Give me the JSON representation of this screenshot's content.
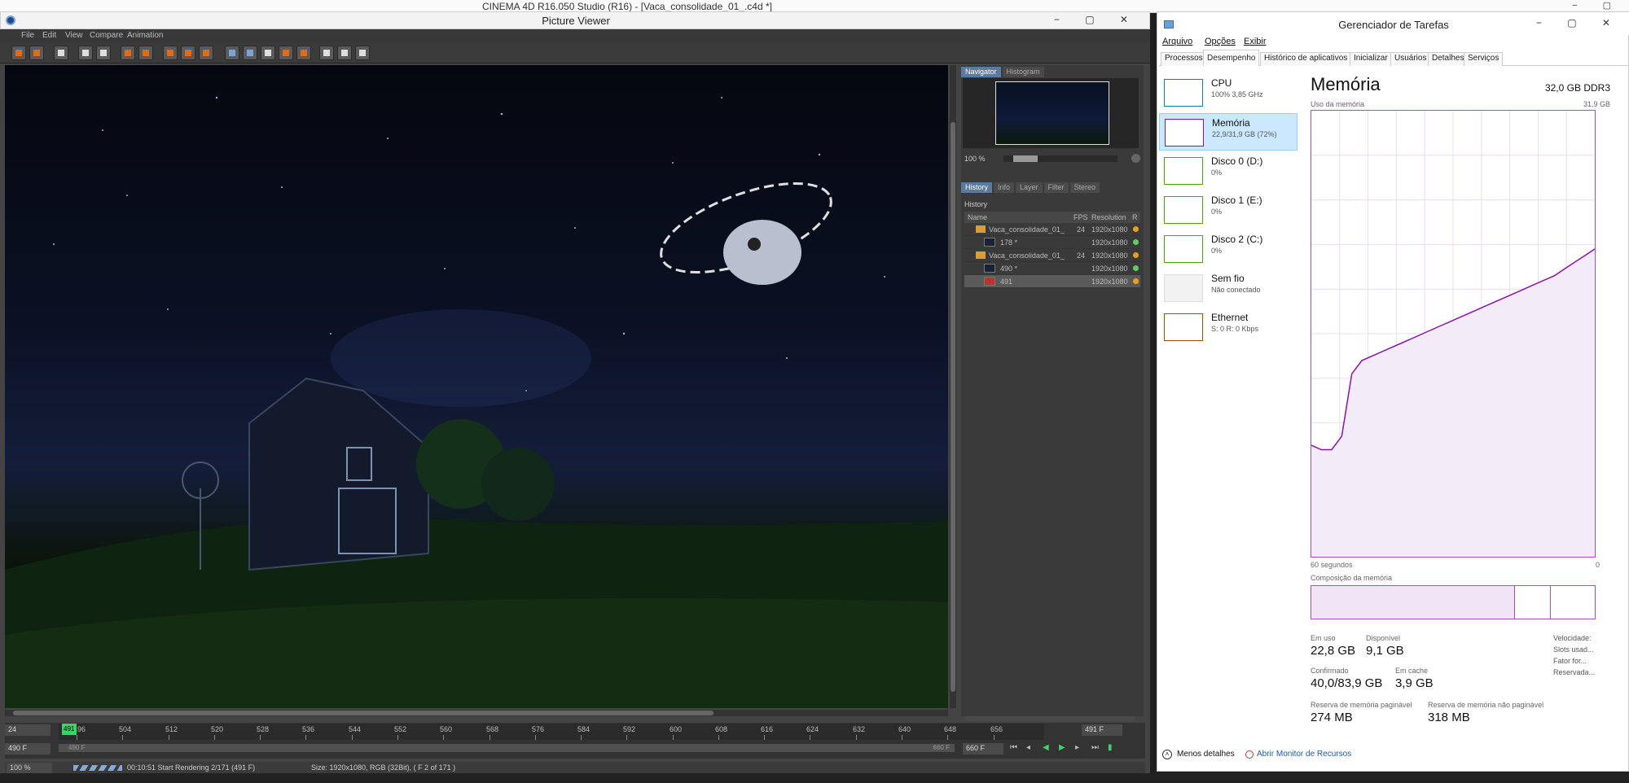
{
  "background_window": {
    "title": "CINEMA 4D R16.050 Studio (R16) - [Vaca_consolidade_01_.c4d *]"
  },
  "picture_viewer": {
    "title": "Picture Viewer",
    "menu": [
      "File",
      "Edit",
      "View",
      "Compare",
      "Animation"
    ],
    "navigator": {
      "tabs": [
        "Navigator",
        "Histogram"
      ],
      "zoom": "100 %"
    },
    "history_tabs": [
      "History",
      "Info",
      "Layer",
      "Filter",
      "Stereo"
    ],
    "history": {
      "label": "History",
      "columns": [
        "Name",
        "FPS",
        "Resolution",
        "R"
      ],
      "rows": [
        {
          "name": "Vaca_consolidade_01_",
          "fps": "24",
          "res": "1920x1080",
          "status": "orange"
        },
        {
          "name": "178 *",
          "fps": "",
          "res": "1920x1080",
          "status": "green"
        },
        {
          "name": "Vaca_consolidade_01_",
          "fps": "24",
          "res": "1920x1080",
          "status": "orange"
        },
        {
          "name": "490 *",
          "fps": "",
          "res": "1920x1080",
          "status": "green"
        },
        {
          "name": "491",
          "fps": "",
          "res": "1920x1080",
          "status": "orange"
        }
      ]
    },
    "timeline": {
      "fps": "24",
      "current": "491",
      "end": "491 F",
      "ticks": [
        "496",
        "504",
        "512",
        "520",
        "528",
        "536",
        "544",
        "552",
        "560",
        "568",
        "576",
        "584",
        "592",
        "600",
        "608",
        "616",
        "624",
        "632",
        "640",
        "648",
        "656"
      ],
      "start_field": "490 F",
      "range_start": "490 F",
      "range_end": "660 F",
      "end_field": "660 F"
    },
    "status": {
      "zoom": "100 %",
      "message": "00:10:51 Start Rendering 2/171 (491 F)",
      "size": "Size: 1920x1080, RGB (32Bit),  ( F 2 of 171 )"
    }
  },
  "task_manager": {
    "title": "Gerenciador de Tarefas",
    "menu": [
      "Arquivo",
      "Opções",
      "Exibir"
    ],
    "tabs": [
      "Processos",
      "Desempenho",
      "Histórico de aplicativos",
      "Inicializar",
      "Usuários",
      "Detalhes",
      "Serviços"
    ],
    "resources": [
      {
        "name": "CPU",
        "sub": "100% 3,85 GHz",
        "color": "#117dbb"
      },
      {
        "name": "Memória",
        "sub": "22,9/31,9 GB (72%)",
        "color": "#8b12ae"
      },
      {
        "name": "Disco 0 (D:)",
        "sub": "0%",
        "color": "#4da60c"
      },
      {
        "name": "Disco 1 (E:)",
        "sub": "0%",
        "color": "#4da60c"
      },
      {
        "name": "Disco 2 (C:)",
        "sub": "0%",
        "color": "#4da60c"
      },
      {
        "name": "Sem fio",
        "sub": "Não conectado",
        "color": "#a74f01"
      },
      {
        "name": "Ethernet",
        "sub": "S: 0 R: 0 Kbps",
        "color": "#a74f01"
      }
    ],
    "memory": {
      "heading": "Memória",
      "total": "32,0 GB DDR3",
      "usage_label": "Uso da memória",
      "max": "31,9 GB",
      "time_left": "60 segundos",
      "time_right": "0",
      "composition_label": "Composição da memória",
      "usage_series": [
        0.25,
        0.24,
        0.24,
        0.27,
        0.41,
        0.44,
        0.45,
        0.46,
        0.47,
        0.48,
        0.49,
        0.5,
        0.51,
        0.52,
        0.53,
        0.54,
        0.55,
        0.56,
        0.57,
        0.58,
        0.59,
        0.6,
        0.61,
        0.62,
        0.63,
        0.645,
        0.66,
        0.675,
        0.69
      ],
      "stats": [
        {
          "label": "Em uso",
          "value": "22,8 GB"
        },
        {
          "label": "Disponível",
          "value": "9,1 GB"
        },
        {
          "label": "Confirmado",
          "value": "40,0/83,9 GB"
        },
        {
          "label": "Em cache",
          "value": "3,9 GB"
        },
        {
          "label": "Reserva de memória paginável",
          "value": "274 MB"
        },
        {
          "label": "Reserva de memória não paginável",
          "value": "318 MB"
        }
      ],
      "right_labels": [
        "Velocidade:",
        "Slots usad...",
        "Fator for...",
        "Reservada..."
      ]
    },
    "footer": {
      "less": "Menos detalhes",
      "monitor": "Abrir Monitor de Recursos"
    },
    "colors": {
      "memory": "#8b12ae",
      "selection": "#cce8ff"
    }
  }
}
